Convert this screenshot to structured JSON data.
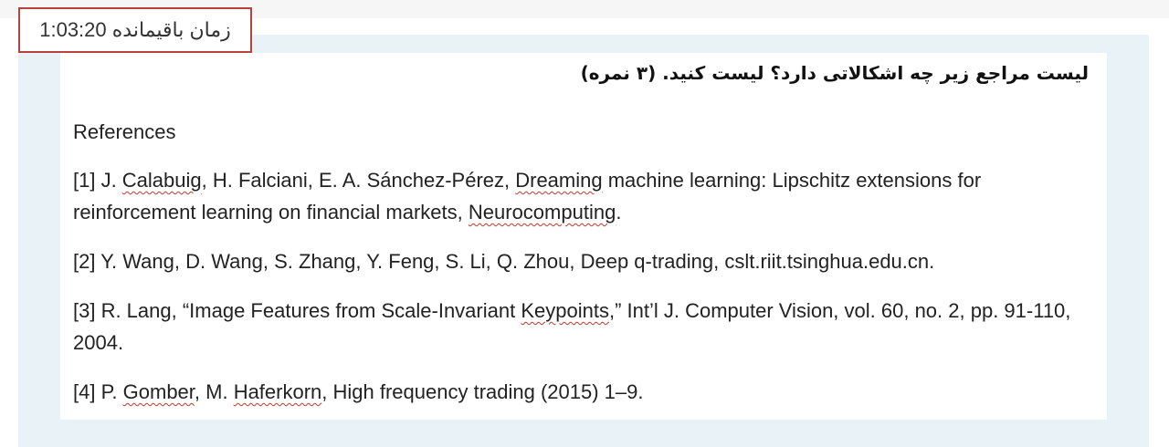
{
  "timer": {
    "label": "زمان باقیمانده",
    "time": "1:03:20"
  },
  "question": {
    "text": "لیست مراجع زیر چه اشکالاتی دارد؟ لیست کنید. (۳ نمره)"
  },
  "references": {
    "heading": "References",
    "ref1": {
      "a": "[1] J. ",
      "b": "Calabuig",
      "c": ", H. Falciani, E. A. Sánchez-Pérez, ",
      "d": "Dreaming",
      "e": " machine learning: Lipschitz extensions for reinforcement learning on financial markets, ",
      "f": "Neurocomputing",
      "g": "."
    },
    "ref2": {
      "text": "[2] Y. Wang, D. Wang, S. Zhang, Y. Feng, S. Li, Q. Zhou, Deep q-trading, cslt.riit.tsinghua.edu.cn."
    },
    "ref3": {
      "a": "[3] R. Lang, “Image Features from Scale-Invariant ",
      "b": "Keypoints",
      "c": ",” Int’l J. Computer Vision, vol. 60, no. 2, pp. 91-110, 2004."
    },
    "ref4": {
      "a": "[4] P. ",
      "b": "Gomber",
      "c": ", M. ",
      "d": "Haferkorn",
      "e": ", High frequency trading (2015) 1–9."
    }
  },
  "colors": {
    "timer_border": "#b7443a",
    "outer_panel": "#e9f2f6",
    "spellcheck_underline": "#c0392b"
  }
}
